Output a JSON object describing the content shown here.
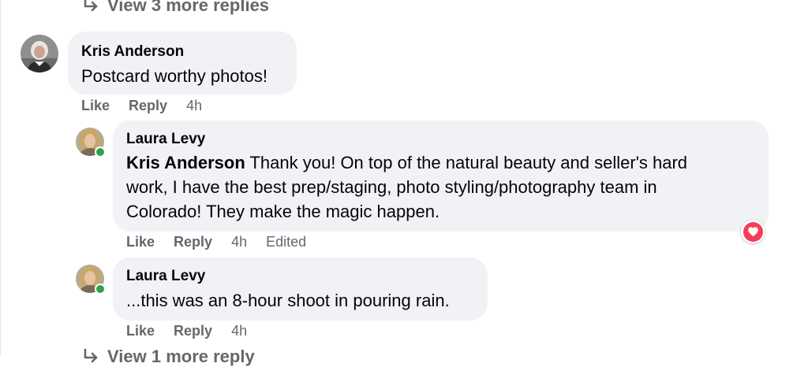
{
  "top_link": {
    "label": "View 3 more replies",
    "icon": "reply-arrow-icon"
  },
  "bottom_link": {
    "label": "View 1 more reply",
    "icon": "reply-arrow-icon"
  },
  "comments": [
    {
      "author": "Kris Anderson",
      "mention": "",
      "text": "Postcard worthy photos!",
      "actions": {
        "like": "Like",
        "reply": "Reply",
        "time": "4h",
        "edited": ""
      }
    },
    {
      "author": "Laura Levy",
      "mention": "Kris Anderson",
      "text_lines": [
        " Thank you! On top of the natural beauty and seller's hard",
        "work, I have the best prep/staging, photo styling/photography team in",
        "Colorado! They make the magic happen."
      ],
      "actions": {
        "like": "Like",
        "reply": "Reply",
        "time": "4h",
        "edited": "Edited"
      },
      "reaction": "heart-icon"
    },
    {
      "author": "Laura Levy",
      "mention": "",
      "text": "...this was an 8-hour shoot in pouring rain.",
      "actions": {
        "like": "Like",
        "reply": "Reply",
        "time": "4h",
        "edited": ""
      }
    }
  ],
  "colors": {
    "bubble": "#f0f2f5",
    "secondary_text": "#65676b",
    "online": "#31a24c",
    "love_reaction": "#f33e58"
  }
}
